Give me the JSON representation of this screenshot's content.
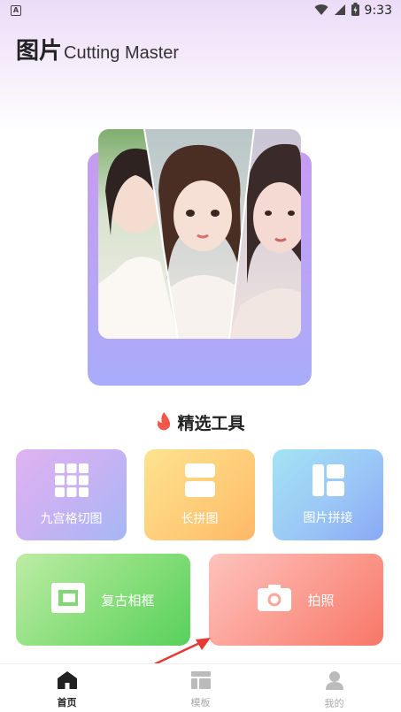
{
  "status_bar": {
    "time": "9:33",
    "left_badge": "A"
  },
  "header": {
    "title_cn": "图片",
    "title_en": "Cutting Master"
  },
  "section": {
    "title": "精选工具"
  },
  "tools": [
    {
      "label": "九宫格切图",
      "icon": "grid-icon"
    },
    {
      "label": "长拼图",
      "icon": "long-stitch-icon"
    },
    {
      "label": "图片拼接",
      "icon": "collage-icon"
    },
    {
      "label": "复古相框",
      "icon": "frame-icon"
    },
    {
      "label": "拍照",
      "icon": "camera-icon"
    }
  ],
  "nav": [
    {
      "label": "首页",
      "icon": "home-icon",
      "active": true
    },
    {
      "label": "模板",
      "icon": "template-icon",
      "active": false
    },
    {
      "label": "我的",
      "icon": "profile-icon",
      "active": false
    }
  ],
  "colors": {
    "grid_card": "#c7b2f3",
    "long_card": "#fecb77",
    "stitch_card": "#9bc7f6",
    "retro_card": "#8adf7c",
    "photo_card": "#fb9a8e",
    "flame": "#f2574a",
    "arrow": "#e53935"
  }
}
